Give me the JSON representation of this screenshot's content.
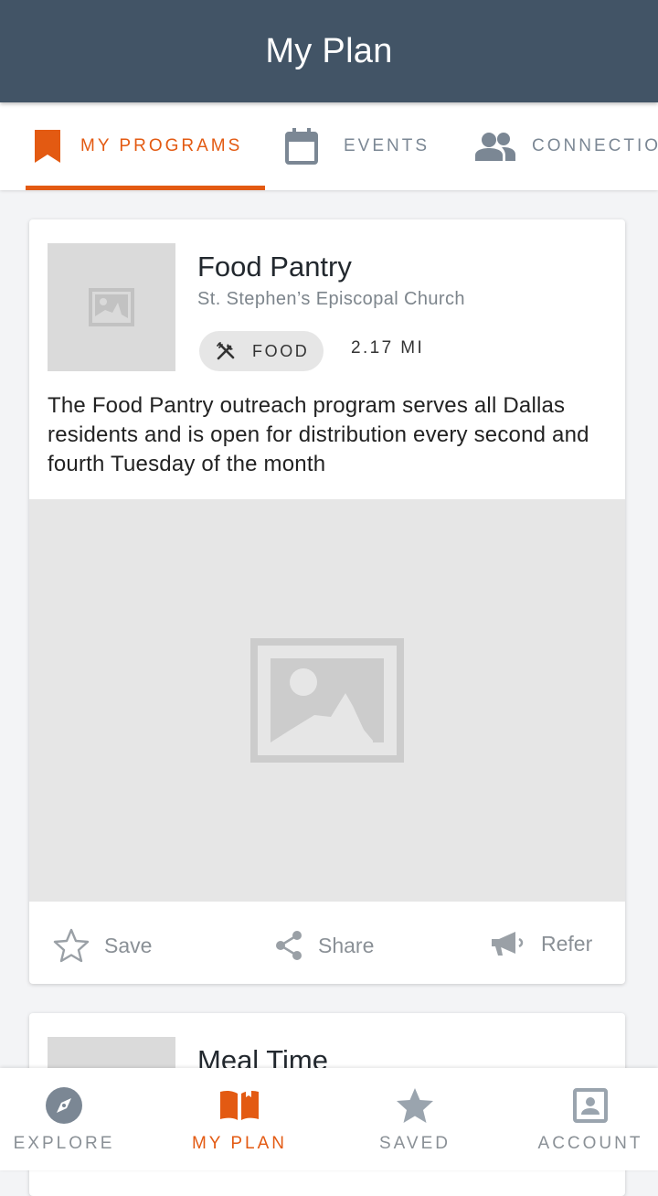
{
  "app_title": "My Plan",
  "tabs": [
    {
      "label": "MY PROGRAMS",
      "icon": "bookmark-icon",
      "active": true
    },
    {
      "label": "EVENTS",
      "icon": "calendar-icon",
      "active": false
    },
    {
      "label": "CONNECTIO",
      "icon": "people-icon",
      "active": false
    }
  ],
  "programs": [
    {
      "title": "Food Pantry",
      "organization": "St. Stephen’s Episcopal Church",
      "category": "FOOD",
      "category_icon": "utensils-icon",
      "distance": "2.17 MI",
      "description": "The Food Pantry outreach program serves all Dallas residents and is open for distribution every second and fourth Tuesday of the month",
      "actions": {
        "save": "Save",
        "share": "Share",
        "refer": "Refer"
      }
    },
    {
      "title": "Meal Time"
    }
  ],
  "bottom_nav": [
    {
      "label": "EXPLORE",
      "icon": "compass-icon",
      "active": false
    },
    {
      "label": "MY PLAN",
      "icon": "book-icon",
      "active": true
    },
    {
      "label": "SAVED",
      "icon": "star-icon",
      "active": false
    },
    {
      "label": "ACCOUNT",
      "icon": "account-icon",
      "active": false
    }
  ],
  "colors": {
    "appbar": "#425466",
    "accent": "#e35a12",
    "inactive": "#7b8794",
    "placeholder": "#dadada"
  }
}
